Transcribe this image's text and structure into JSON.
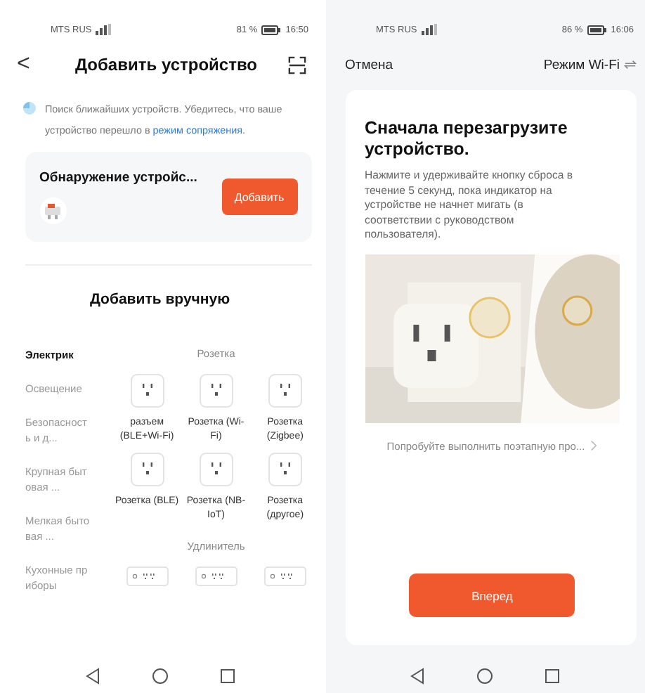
{
  "left": {
    "status_bar": {
      "carrier": "MTS RUS",
      "battery": "81 %",
      "time": "16:50"
    },
    "header": {
      "back": "<",
      "title": "Добавить устройство"
    },
    "notice": {
      "text": "Поиск ближайших устройств. Убедитесь, что ваше устройство перешло в ",
      "link": "режим сопряжения",
      "end": "."
    },
    "discovery": {
      "title": "Обнаружение устройс...",
      "button": "Добавить"
    },
    "manual_title": "Добавить вручную",
    "categories": [
      {
        "label": "Электрик",
        "selected": true
      },
      {
        "label": "Освещение",
        "selected": false
      },
      {
        "label": "Безопасность и д...",
        "selected": false
      },
      {
        "label": "Крупная бытовая ...",
        "selected": false
      },
      {
        "label": "Мелкая бытовая ...",
        "selected": false
      },
      {
        "label": "Кухонные приборы",
        "selected": false
      }
    ],
    "sections": [
      {
        "title": "Розетка",
        "devices": [
          {
            "kind": "socket",
            "name": "разъем (BLE+Wi-Fi)"
          },
          {
            "kind": "socket",
            "name": "Розетка (Wi-Fi)"
          },
          {
            "kind": "socket",
            "name": "Розетка (Zigbee)"
          },
          {
            "kind": "socket",
            "name": "Розетка (BLE)"
          },
          {
            "kind": "socket",
            "name": "Розетка (NB-IoT)"
          },
          {
            "kind": "socket",
            "name": "Розетка (другое)"
          }
        ]
      },
      {
        "title": "Удлинитель",
        "devices": [
          {
            "kind": "strip"
          },
          {
            "kind": "strip"
          },
          {
            "kind": "strip"
          }
        ]
      }
    ]
  },
  "right": {
    "status_bar": {
      "carrier": "MTS RUS",
      "battery": "86 %",
      "time": "16:06"
    },
    "header": {
      "cancel": "Отмена",
      "mode": "Режим Wi-Fi"
    },
    "card": {
      "title": "Сначала перезагрузите устройство.",
      "description": "Нажмите и удерживайте кнопку сброса в течение 5 секунд, пока индикатор на устройстве не начнет мигать (в соответствии с руководством пользователя).",
      "link": "Попробуйте выполнить поэтапную про...",
      "button": "Вперед"
    }
  }
}
